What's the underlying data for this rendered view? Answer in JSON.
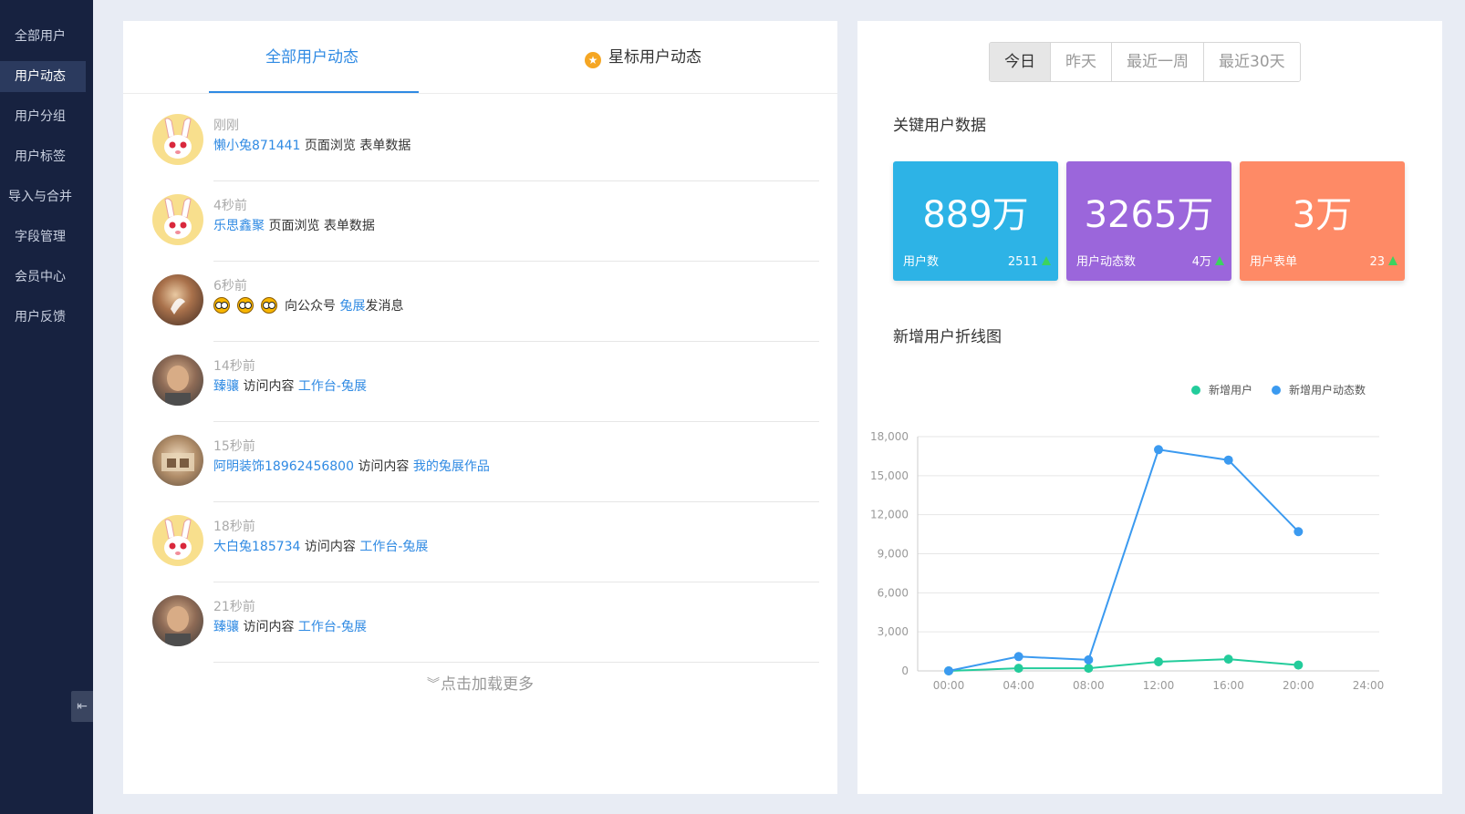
{
  "sidebar": {
    "items": [
      {
        "label": "全部用户"
      },
      {
        "label": "用户动态"
      },
      {
        "label": "用户分组"
      },
      {
        "label": "用户标签"
      },
      {
        "label": "导入与合并"
      },
      {
        "label": "字段管理"
      },
      {
        "label": "会员中心"
      },
      {
        "label": "用户反馈"
      }
    ],
    "active_index": 1,
    "collapse_glyph": "⇤"
  },
  "feed": {
    "tabs": [
      {
        "label": "全部用户动态"
      },
      {
        "label": "星标用户动态"
      }
    ],
    "star_glyph": "★",
    "items": [
      {
        "time": "刚刚",
        "user": "懒小兔871441",
        "action": "页面浏览 表单数据",
        "target": "",
        "suffix": ""
      },
      {
        "time": "4秒前",
        "user": "乐思鑫聚",
        "action": "页面浏览 表单数据",
        "target": "",
        "suffix": ""
      },
      {
        "time": "6秒前",
        "user": "",
        "action": "向公众号",
        "target": "兔展",
        "suffix": "发消息"
      },
      {
        "time": "14秒前",
        "user": "臻骧",
        "action": "访问内容",
        "target": "工作台-兔展",
        "suffix": ""
      },
      {
        "time": "15秒前",
        "user": "阿明装饰18962456800",
        "action": "访问内容",
        "target": "我的兔展作品",
        "suffix": ""
      },
      {
        "time": "18秒前",
        "user": "大白兔185734",
        "action": "访问内容",
        "target": "工作台-兔展",
        "suffix": ""
      },
      {
        "time": "21秒前",
        "user": "臻骧",
        "action": "访问内容",
        "target": "工作台-兔展",
        "suffix": ""
      }
    ],
    "load_more": "点击加载更多",
    "load_more_glyph": "︾"
  },
  "range": {
    "options": [
      "今日",
      "昨天",
      "最近一周",
      "最近30天"
    ],
    "active_index": 0
  },
  "stats": {
    "title": "关键用户数据",
    "cards": [
      {
        "value": "889万",
        "label": "用户数",
        "delta": "2511",
        "color": "#2db3e6"
      },
      {
        "value": "3265万",
        "label": "用户动态数",
        "delta": "4万",
        "color": "#9b66db"
      },
      {
        "value": "3万",
        "label": "用户表单",
        "delta": "23",
        "color": "#fe8a66"
      }
    ]
  },
  "chart_title": "新增用户折线图",
  "chart_data": {
    "type": "line",
    "x": [
      "00:00",
      "04:00",
      "08:00",
      "12:00",
      "16:00",
      "20:00",
      "24:00"
    ],
    "series": [
      {
        "name": "新增用户",
        "color": "#23cc9b",
        "values": [
          0,
          200,
          200,
          700,
          900,
          450,
          null
        ]
      },
      {
        "name": "新增用户动态数",
        "color": "#3b9af0",
        "values": [
          0,
          1100,
          850,
          17000,
          16200,
          10700,
          null
        ]
      }
    ],
    "yticks": [
      0,
      3000,
      6000,
      9000,
      12000,
      15000,
      18000
    ],
    "ytick_labels": [
      "0",
      "3,000",
      "6,000",
      "9,000",
      "12,000",
      "15,000",
      "18,000"
    ],
    "ylim": [
      0,
      18000
    ],
    "grid": true,
    "legend_position": "top-right"
  }
}
